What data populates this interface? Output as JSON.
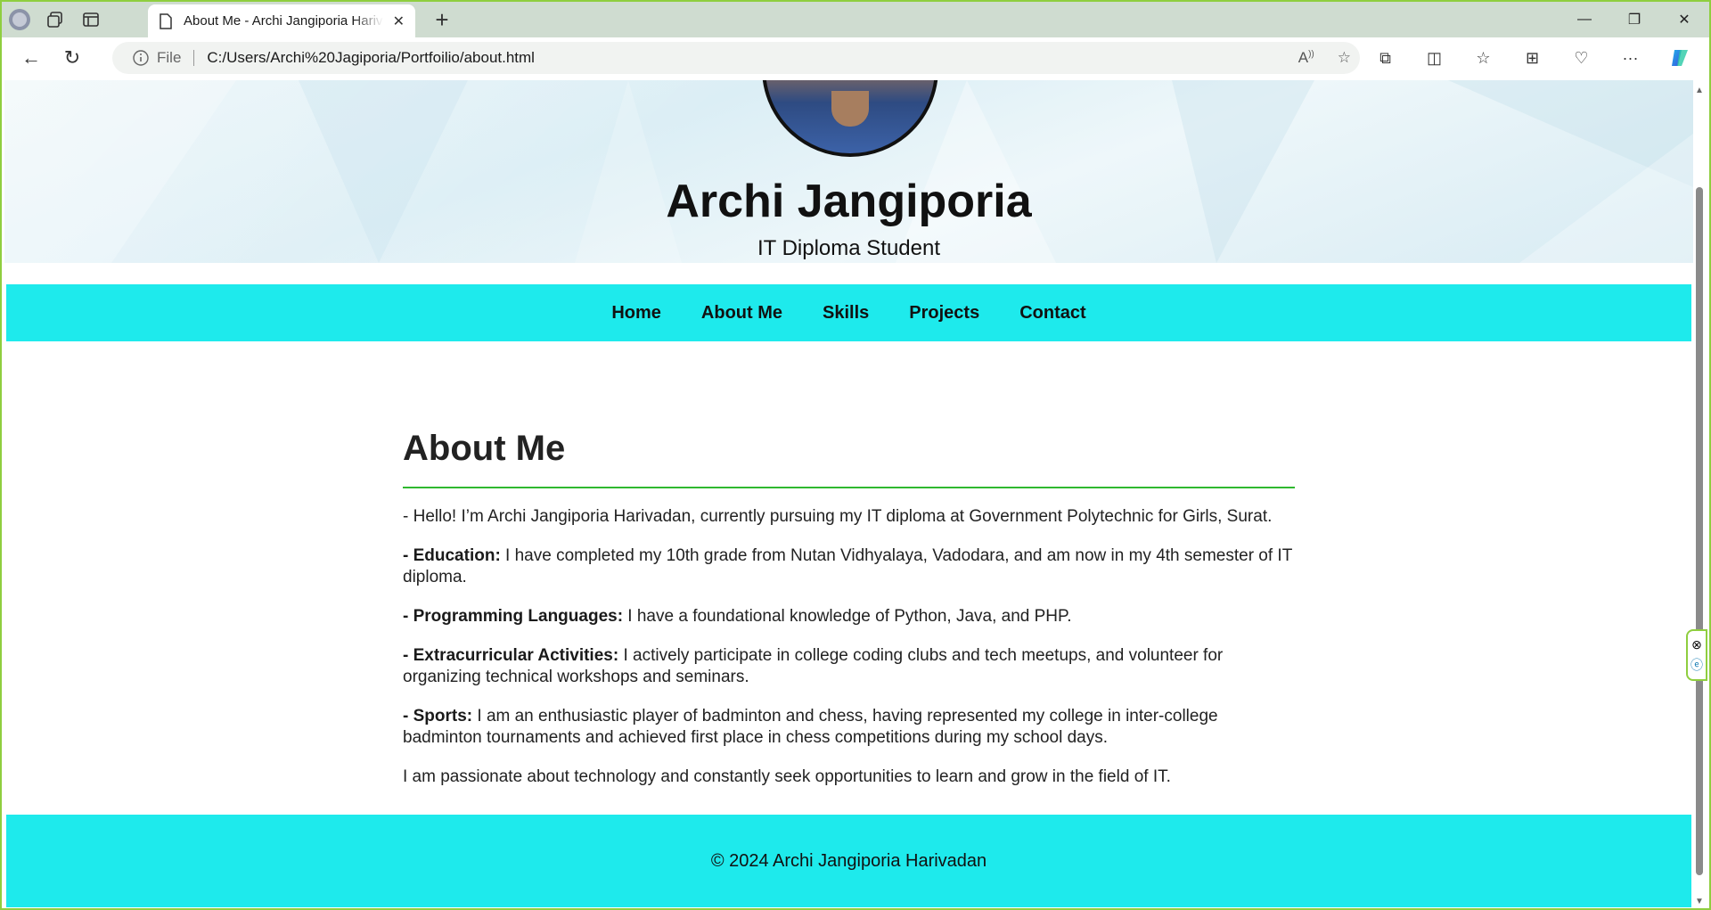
{
  "browser": {
    "tab_title": "About Me - Archi Jangiporia Harivadan",
    "address_prefix": "File",
    "url": "C:/Users/Archi%20Jagiporia/Portfoilio/about.html"
  },
  "hero": {
    "name": "Archi Jangiporia",
    "subtitle": "IT Diploma Student"
  },
  "nav": {
    "items": [
      "Home",
      "About Me",
      "Skills",
      "Projects",
      "Contact"
    ]
  },
  "about": {
    "heading": "About Me",
    "intro": "- Hello! I’m Archi Jangiporia Harivadan, currently pursuing my IT diploma at Government Polytechnic for Girls, Surat.",
    "sections": [
      {
        "label": "- Education:",
        "text": " I have completed my 10th grade from Nutan Vidhyalaya, Vadodara, and am now in my 4th semester of IT diploma."
      },
      {
        "label": "- Programming Languages:",
        "text": " I have a foundational knowledge of Python, Java, and PHP."
      },
      {
        "label": "- Extracurricular Activities:",
        "text": " I actively participate in college coding clubs and tech meetups, and volunteer for organizing technical workshops and seminars."
      },
      {
        "label": "- Sports:",
        "text": " I am an enthusiastic player of badminton and chess, having represented my college in inter-college badminton tournaments and achieved first place in chess competitions during my school days."
      }
    ],
    "closing": "I am passionate about technology and constantly seek opportunities to learn and grow in the field of IT."
  },
  "footer": {
    "text": "© 2024 Archi Jangiporia Harivadan"
  },
  "colors": {
    "accent": "#1eeaec",
    "rule": "#2fb82f",
    "window_border": "#8fce3f"
  }
}
